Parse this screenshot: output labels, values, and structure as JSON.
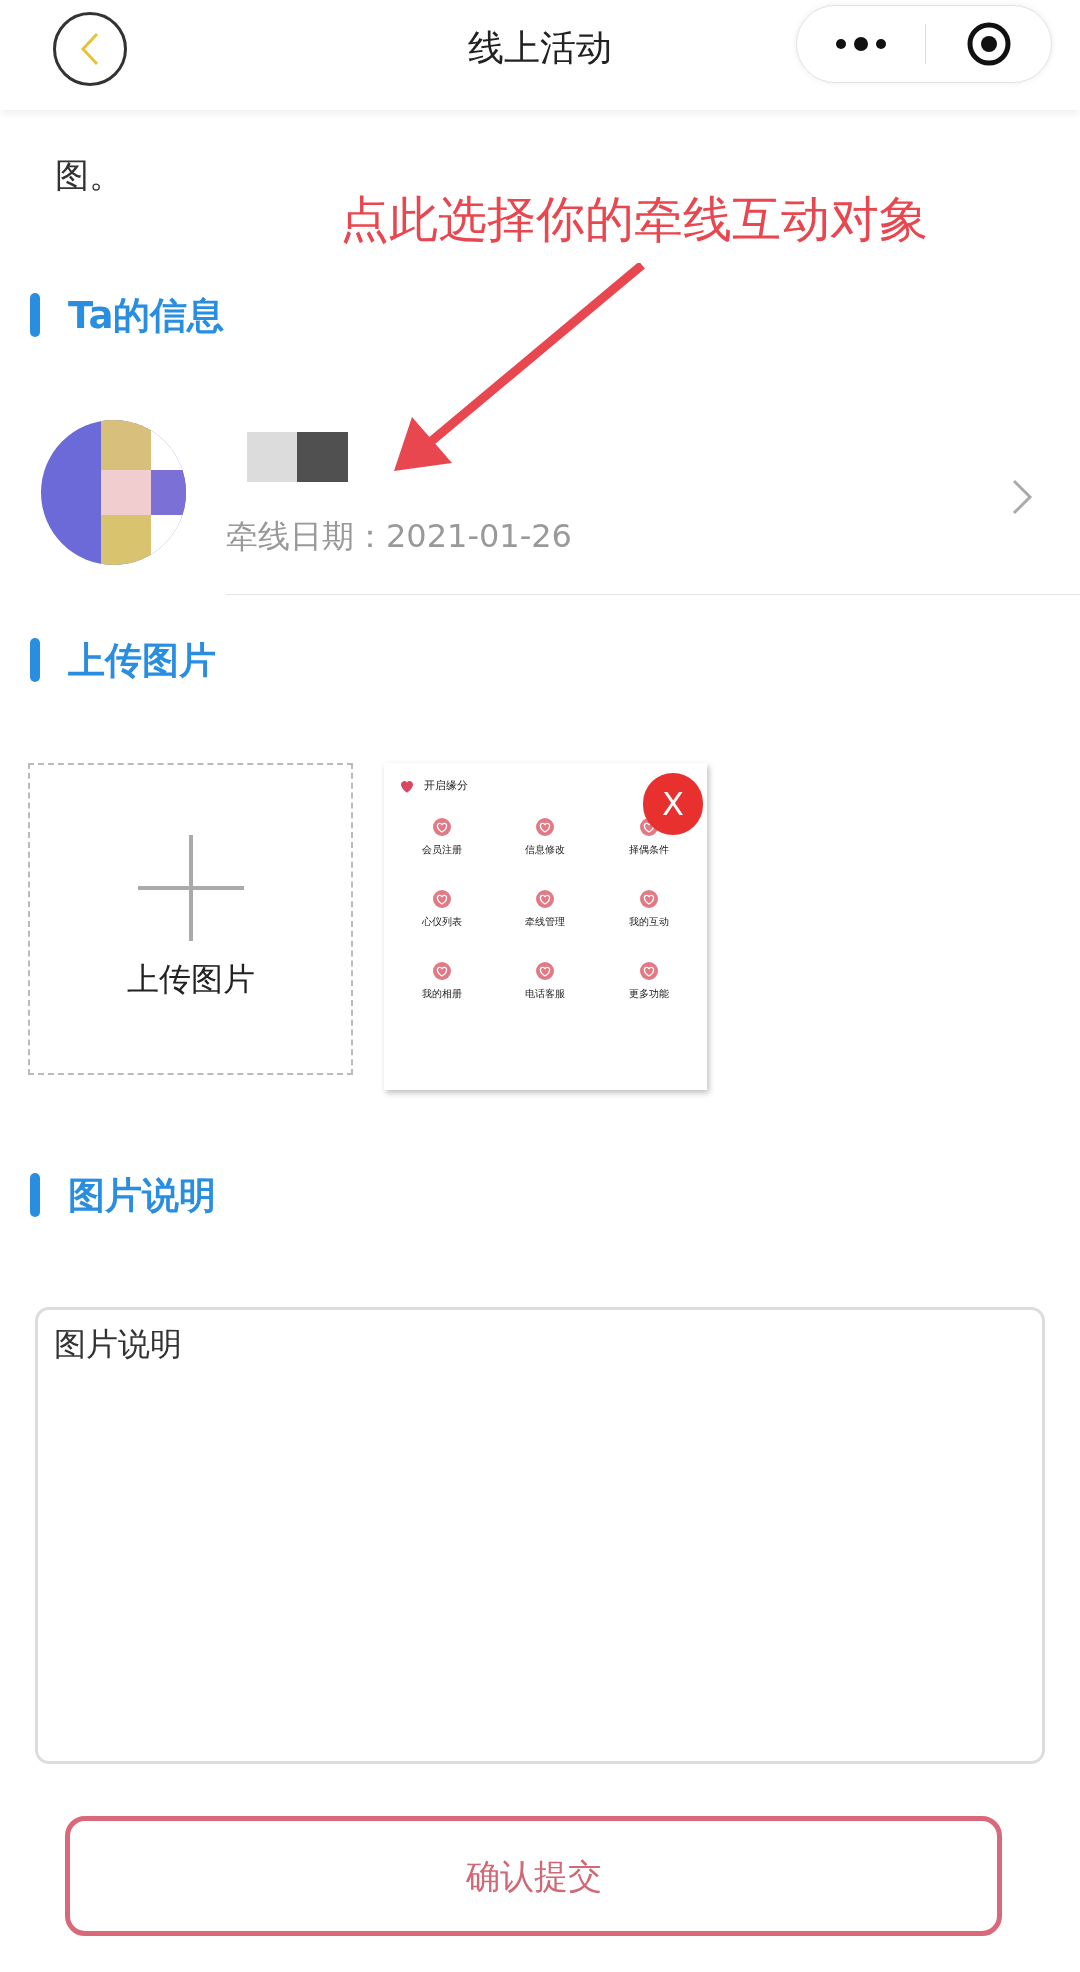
{
  "header": {
    "title": "线上活动"
  },
  "intro": {
    "text": "图。"
  },
  "annotation": {
    "text": "点此选择你的牵线互动对象"
  },
  "partner_section": {
    "title": "Ta的信息"
  },
  "partner": {
    "date": "牵线日期：2021-01-26"
  },
  "upload_section": {
    "title": "上传图片"
  },
  "upload": {
    "label": "上传图片"
  },
  "thumbnail": {
    "title": "开启缘分",
    "close": "X",
    "items": [
      {
        "label": "会员注册"
      },
      {
        "label": "信息修改"
      },
      {
        "label": "择偶条件"
      },
      {
        "label": "心仪列表"
      },
      {
        "label": "牵线管理"
      },
      {
        "label": "我的互动"
      },
      {
        "label": "我的相册"
      },
      {
        "label": "电话客服"
      },
      {
        "label": "更多功能"
      }
    ]
  },
  "caption_section": {
    "title": "图片说明"
  },
  "caption": {
    "placeholder": "图片说明"
  },
  "submit": {
    "label": "确认提交"
  }
}
